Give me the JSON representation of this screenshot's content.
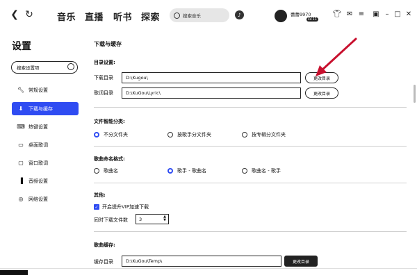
{
  "topbar": {
    "back_icon": "chevron-left-icon",
    "refresh_icon": "refresh-icon",
    "tabs": [
      "音乐",
      "直播",
      "听书",
      "探索"
    ],
    "search_placeholder": "搜索音乐",
    "user_name": "蕾蕾9970",
    "user_badge": "LV.11",
    "window_icons": [
      "shirt-icon",
      "mail-icon",
      "menu-icon",
      "mini-player-icon",
      "minimize-icon",
      "maximize-icon",
      "close-icon"
    ]
  },
  "sidebar": {
    "title": "设置",
    "search_placeholder": "搜索设置项",
    "items": [
      {
        "label": "常规设置",
        "icon": "wrench-icon",
        "active": false
      },
      {
        "label": "下载与缓存",
        "icon": "download-icon",
        "active": true
      },
      {
        "label": "热键设置",
        "icon": "keyboard-icon",
        "active": false
      },
      {
        "label": "桌面歌词",
        "icon": "monitor-icon",
        "active": false
      },
      {
        "label": "窗口歌词",
        "icon": "window-icon",
        "active": false
      },
      {
        "label": "音频设置",
        "icon": "audio-icon",
        "active": false
      },
      {
        "label": "网络设置",
        "icon": "network-icon",
        "active": false
      }
    ]
  },
  "main": {
    "section_title": "下载与缓存",
    "dir_settings": {
      "heading": "目录设置:",
      "download_label": "下载目录",
      "download_path": "D:\\Kugou\\",
      "lyrics_label": "歌词目录",
      "lyrics_path": "D:\\KuGou\\Lyric\\",
      "change_btn": "更改目录"
    },
    "file_classify": {
      "heading": "文件智能分类:",
      "options": [
        "不分文件夹",
        "按歌手分文件夹",
        "按专辑分文件夹"
      ],
      "selected": 0
    },
    "song_naming": {
      "heading": "歌曲命名格式:",
      "options": [
        "歌曲名",
        "歌手 - 歌曲名",
        "歌曲名 - 歌手"
      ],
      "selected": 1
    },
    "other": {
      "heading": "其他:",
      "vip_checkbox": "开启提升VIP加速下载",
      "concurrent_label": "同时下载文件数",
      "concurrent_value": "3"
    },
    "cache": {
      "heading": "歌曲缓存:",
      "cache_label": "缓存目录",
      "cache_path": "D:\\KuGou\\Temp\\",
      "change_btn": "更改目录"
    }
  },
  "colors": {
    "accent": "#2f4cf2",
    "annotation_arrow": "#c8102e"
  }
}
